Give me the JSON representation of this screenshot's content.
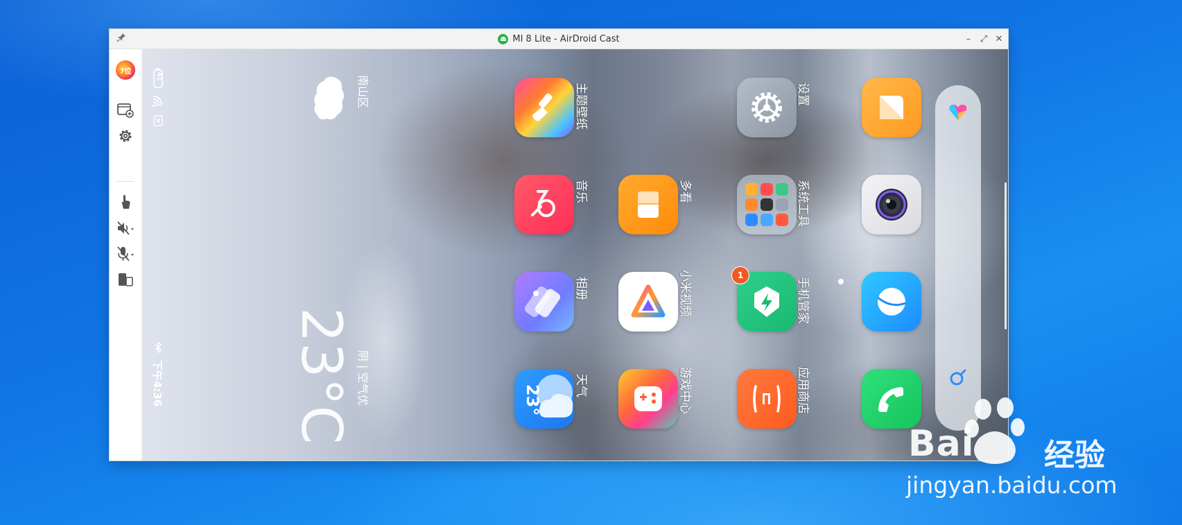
{
  "window": {
    "title": "MI 8 Lite - AirDroid Cast",
    "controls": {
      "minimize": "–",
      "maximize": "⤢",
      "close": "✕"
    }
  },
  "toolbar": {
    "avatar_text": "7位",
    "icons": [
      "avatar",
      "screenshot-icon",
      "settings-icon",
      "touch-control-icon",
      "speaker-muted-icon",
      "mic-muted-icon",
      "screen-rotate-icon"
    ]
  },
  "phone": {
    "status": {
      "time": "下午4:36",
      "battery": "41"
    },
    "weather": {
      "location": "南山区",
      "temperature": "23°C",
      "description": "阴 | 空气优"
    },
    "apps": [
      {
        "id": "theme",
        "label": "主题壁纸"
      },
      {
        "id": "settings",
        "label": "设置"
      },
      {
        "id": "notes",
        "label": ""
      },
      {
        "id": "music",
        "label": "音乐"
      },
      {
        "id": "duokan",
        "label": "多看"
      },
      {
        "id": "tools",
        "label": "系统工具"
      },
      {
        "id": "camera",
        "label": ""
      },
      {
        "id": "gallery",
        "label": "相册"
      },
      {
        "id": "mivideo",
        "label": "小米视频"
      },
      {
        "id": "security",
        "label": "手机管家",
        "badge": "1"
      },
      {
        "id": "browser",
        "label": ""
      },
      {
        "id": "weather",
        "label": "天气",
        "icon_text": "23°"
      },
      {
        "id": "games",
        "label": "游戏中心"
      },
      {
        "id": "appstore",
        "label": "应用商店"
      },
      {
        "id": "phone",
        "label": ""
      }
    ]
  },
  "watermark": {
    "brand": "Bai",
    "brand2": "经验",
    "url": "jingyan.baidu.com"
  },
  "colors": {
    "desktop": "#1177e6",
    "accent": "#2fb04a",
    "badge": "#f05a22"
  }
}
